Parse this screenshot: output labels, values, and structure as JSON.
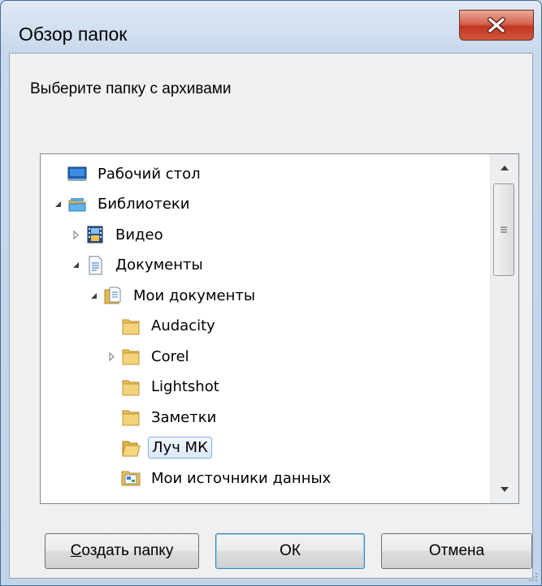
{
  "window": {
    "title": "Обзор папок"
  },
  "dialog": {
    "prompt": "Выберите папку с архивами"
  },
  "tree": {
    "items": [
      {
        "label": "Рабочий стол",
        "level": 0,
        "expander": "none",
        "icon": "desktop-icon"
      },
      {
        "label": "Библиотеки",
        "level": 0,
        "expander": "expanded",
        "icon": "libraries-icon"
      },
      {
        "label": "Видео",
        "level": 1,
        "expander": "collapsed",
        "icon": "video-library-icon"
      },
      {
        "label": "Документы",
        "level": 1,
        "expander": "expanded",
        "icon": "documents-library-icon"
      },
      {
        "label": "Мои документы",
        "level": 2,
        "expander": "expanded",
        "icon": "documents-folder-icon"
      },
      {
        "label": "Audacity",
        "level": 3,
        "expander": "none",
        "icon": "folder-icon"
      },
      {
        "label": "Corel",
        "level": 3,
        "expander": "collapsed",
        "icon": "folder-icon"
      },
      {
        "label": "Lightshot",
        "level": 3,
        "expander": "none",
        "icon": "folder-icon"
      },
      {
        "label": "Заметки",
        "level": 3,
        "expander": "none",
        "icon": "folder-icon"
      },
      {
        "label": "Луч МК",
        "level": 3,
        "expander": "none",
        "icon": "folder-open-icon",
        "selected": true
      },
      {
        "label": "Мои источники данных",
        "level": 3,
        "expander": "none",
        "icon": "data-sources-folder-icon"
      }
    ]
  },
  "buttons": {
    "new_folder_prefix": "С",
    "new_folder_rest": "оздать папку",
    "ok": "ОК",
    "cancel": "Отмена"
  },
  "colors": {
    "selection_border": "#84acdd",
    "close_button": "#c0371f"
  }
}
